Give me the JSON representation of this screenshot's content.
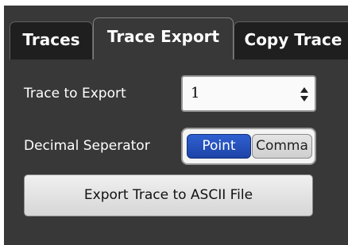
{
  "tabs": [
    {
      "label": "Traces"
    },
    {
      "label": "Trace Export"
    },
    {
      "label": "Copy Trace"
    }
  ],
  "active_tab": "Trace Export",
  "trace_to_export": {
    "label": "Trace to Export",
    "value": "1"
  },
  "decimal_separator": {
    "label": "Decimal Seperator",
    "options": [
      "Point",
      "Comma"
    ],
    "selected": "Point"
  },
  "export_button": {
    "label": "Export Trace to ASCII File"
  },
  "colors": {
    "panel_bg": "#383838",
    "accent_selected": "#2451c0"
  },
  "icons": {
    "dropdown": "up-down-arrows-icon"
  }
}
